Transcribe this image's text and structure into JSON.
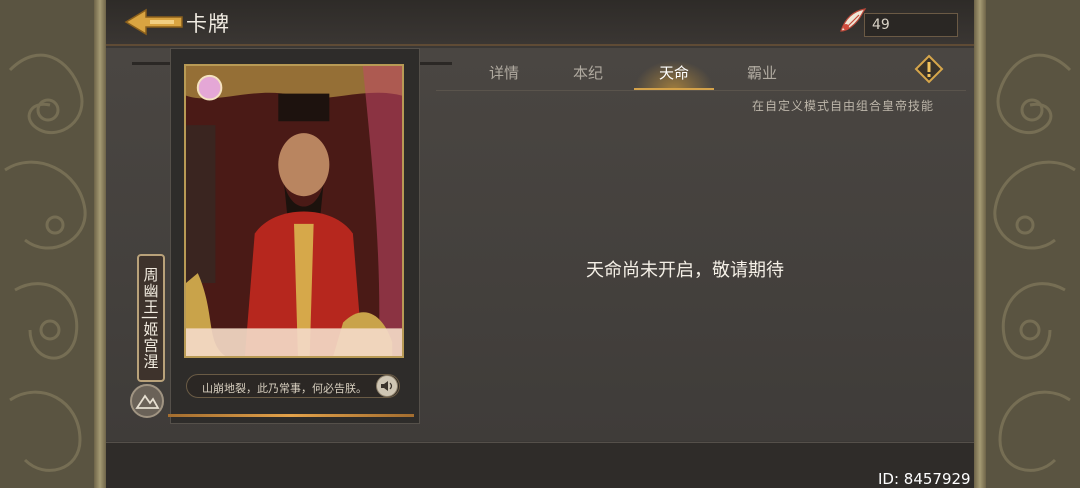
{
  "header": {
    "title": "卡牌",
    "currency_value": "49",
    "back_icon": "arrow-left-icon",
    "currency_icon": "feather-wing-icon"
  },
  "card": {
    "vertical_name": "周幽王|姬宫湦",
    "quote": "山崩地裂，此乃常事，何必告朕。",
    "speaker_icon": "speaker-icon",
    "emblem_icon": "mountain-emblem-icon"
  },
  "tabs": {
    "items": [
      {
        "label": "详情"
      },
      {
        "label": "本纪"
      },
      {
        "label": "天命"
      },
      {
        "label": "霸业"
      }
    ],
    "active_index": 2,
    "hint": "在自定义模式自由组合皇帝技能",
    "info_icon": "exclamation-diamond-icon"
  },
  "main": {
    "message": "天命尚未开启，敬请期待"
  },
  "footer": {
    "id_label": "ID: 8457929"
  },
  "colors": {
    "accent_gold": "#d4a24a",
    "panel_bg": "#3b3835",
    "card_red": "#7d2a22"
  }
}
